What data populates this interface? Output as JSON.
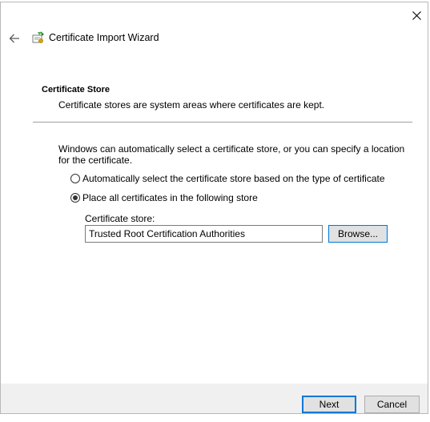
{
  "window": {
    "title": "Certificate Import Wizard"
  },
  "icons": {
    "back": "back-arrow-icon",
    "close": "close-icon",
    "wizard": "certificate-wizard-icon"
  },
  "page": {
    "heading": "Certificate Store",
    "description": "Certificate stores are system areas where certificates are kept.",
    "intro": "Windows can automatically select a certificate store, or you can specify a location for the certificate."
  },
  "options": {
    "auto_label": "Automatically select the certificate store based on the type of certificate",
    "auto_selected": false,
    "place_label": "Place all certificates in the following store",
    "place_selected": true
  },
  "store": {
    "label": "Certificate store:",
    "value": "Trusted Root Certification Authorities",
    "browse_label": "Browse..."
  },
  "footer": {
    "next_label": "Next",
    "cancel_label": "Cancel"
  },
  "colors": {
    "accent": "#0078d7",
    "footer_bg": "#f0f0f0",
    "button_bg": "#e1e1e1"
  }
}
